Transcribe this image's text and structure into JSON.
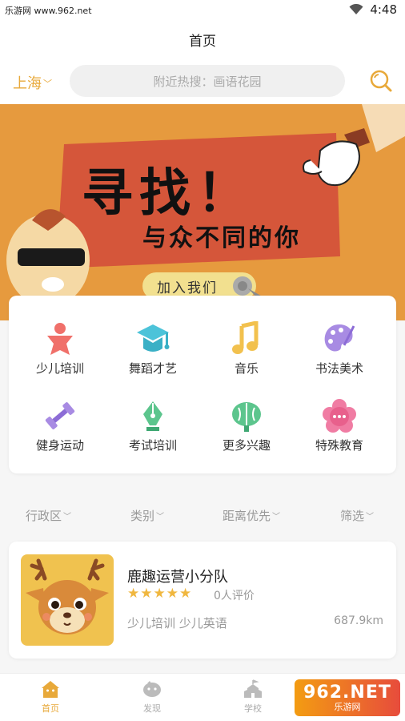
{
  "status_bar": {
    "carrier": "乐游网 www.962.net",
    "time": "4:48"
  },
  "header": {
    "title": "首页"
  },
  "search": {
    "city": "上海",
    "placeholder": "附近热搜：画语花园"
  },
  "banner": {
    "headline": "寻找！",
    "subline": "与众不同的你",
    "cta": "加入我们"
  },
  "categories": [
    {
      "label": "少儿培训",
      "icon": "child-icon",
      "color": "#f0706a"
    },
    {
      "label": "舞蹈才艺",
      "icon": "graduation-cap-icon",
      "color": "#4cc3d9"
    },
    {
      "label": "音乐",
      "icon": "music-note-icon",
      "color": "#f2c14e"
    },
    {
      "label": "书法美术",
      "icon": "palette-icon",
      "color": "#a88be3"
    },
    {
      "label": "健身运动",
      "icon": "dumbbell-icon",
      "color": "#a88be3"
    },
    {
      "label": "考试培训",
      "icon": "pen-nib-icon",
      "color": "#5cc58d"
    },
    {
      "label": "更多兴趣",
      "icon": "brain-icon",
      "color": "#5cc58d"
    },
    {
      "label": "特殊教育",
      "icon": "chat-flower-icon",
      "color": "#f07ca3"
    }
  ],
  "filters": [
    {
      "label": "行政区"
    },
    {
      "label": "类别"
    },
    {
      "label": "距离优先"
    },
    {
      "label": "筛选"
    }
  ],
  "school": {
    "name": "鹿趣运营小分队",
    "stars": "★★★★★",
    "reviews": "0人评价",
    "tags": "少儿培训 少儿英语",
    "distance": "687.9km"
  },
  "tabs": [
    {
      "label": "首页",
      "icon": "home-icon",
      "active": true
    },
    {
      "label": "发现",
      "icon": "discover-icon",
      "active": false
    },
    {
      "label": "学校",
      "icon": "school-icon",
      "active": false
    }
  ],
  "watermark": {
    "big": "962.NET",
    "small": "乐游网"
  },
  "colors": {
    "accent": "#e8a93a",
    "banner_bg": "#e69a3e",
    "banner_ribbon": "#d5563a"
  }
}
